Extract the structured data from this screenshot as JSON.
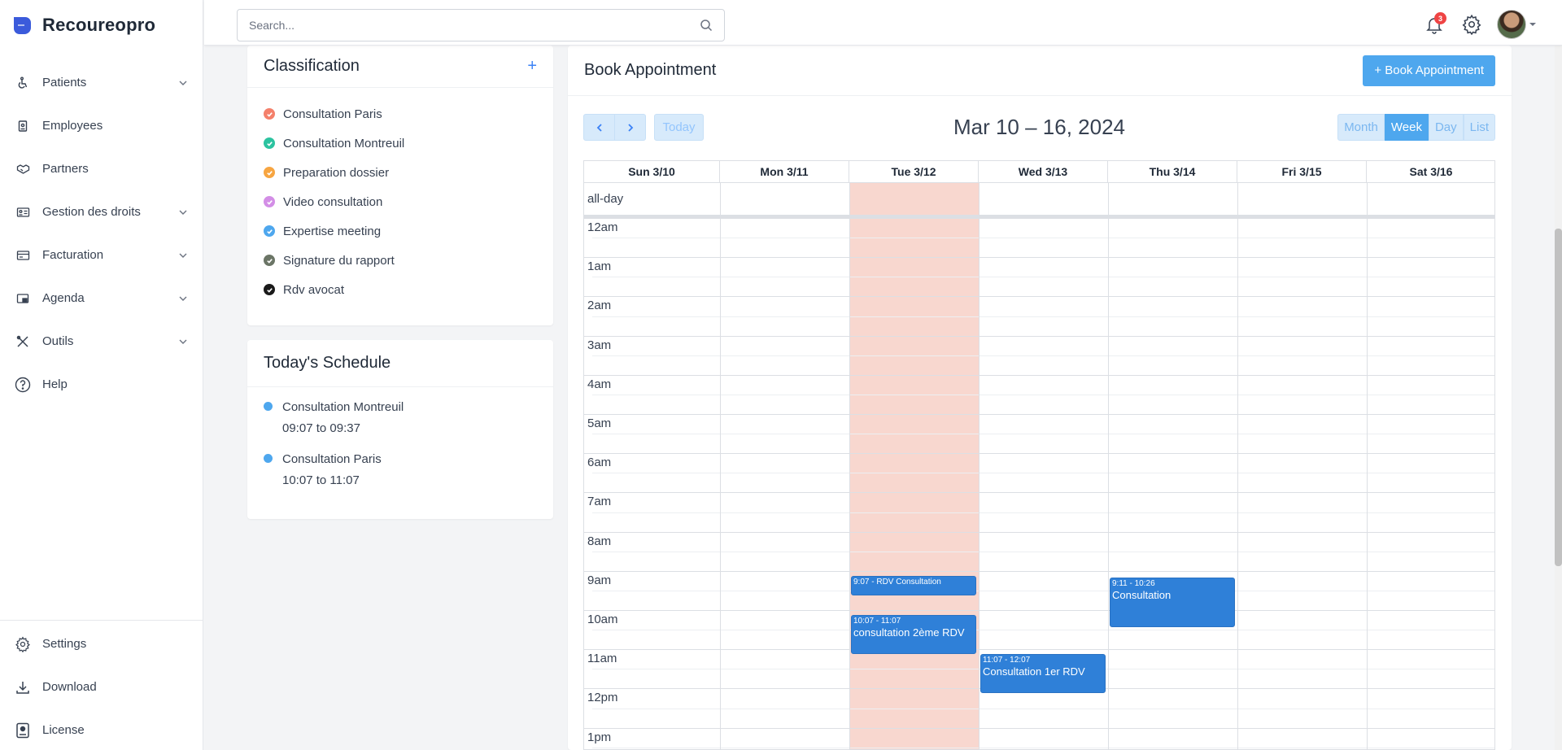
{
  "brand": {
    "name": "Recoureopro"
  },
  "sidebar": {
    "items": [
      {
        "label": "Patients",
        "icon": "wheelchair-icon",
        "has_submenu": true
      },
      {
        "label": "Employees",
        "icon": "badge-icon",
        "has_submenu": false
      },
      {
        "label": "Partners",
        "icon": "handshake-icon",
        "has_submenu": false
      },
      {
        "label": "Gestion des droits",
        "icon": "id-card-icon",
        "has_submenu": true
      },
      {
        "label": "Facturation",
        "icon": "billing-icon",
        "has_submenu": true
      },
      {
        "label": "Agenda",
        "icon": "calendar-icon",
        "has_submenu": true
      },
      {
        "label": "Outils",
        "icon": "tools-icon",
        "has_submenu": true
      },
      {
        "label": "Help",
        "icon": "help-icon",
        "has_submenu": false
      }
    ],
    "bottom": [
      {
        "label": "Settings",
        "icon": "gear-icon"
      },
      {
        "label": "Download",
        "icon": "download-icon"
      },
      {
        "label": "License",
        "icon": "license-icon"
      }
    ]
  },
  "topbar": {
    "search_placeholder": "Search...",
    "notification_count": "3"
  },
  "classification": {
    "title": "Classification",
    "add_label": "+",
    "items": [
      {
        "label": "Consultation Paris",
        "color": "#f4806b"
      },
      {
        "label": "Consultation Montreuil",
        "color": "#2cc3a0"
      },
      {
        "label": "Preparation dossier",
        "color": "#f7a541"
      },
      {
        "label": "Video consultation",
        "color": "#d38ee6"
      },
      {
        "label": "Expertise meeting",
        "color": "#4ea7ee"
      },
      {
        "label": "Signature du rapport",
        "color": "#6b7566"
      },
      {
        "label": "Rdv avocat",
        "color": "#1a1a1a"
      }
    ]
  },
  "schedule": {
    "title": "Today's Schedule",
    "items": [
      {
        "title": "Consultation Montreuil",
        "time": "09:07 to 09:37"
      },
      {
        "title": "Consultation Paris",
        "time": "10:07 to 11:07"
      }
    ]
  },
  "calendar": {
    "title": "Book Appointment",
    "book_button": "+ Book Appointment",
    "range_title": "Mar 10 – 16, 2024",
    "today_label": "Today",
    "views": [
      "Month",
      "Week",
      "Day",
      "List"
    ],
    "active_view": "Week",
    "days": [
      "Sun 3/10",
      "Mon 3/11",
      "Tue 3/12",
      "Wed 3/13",
      "Thu 3/14",
      "Fri 3/15",
      "Sat 3/16"
    ],
    "today_index": 2,
    "allday_label": "all-day",
    "hours": [
      "12am",
      "1am",
      "2am",
      "3am",
      "4am",
      "5am",
      "6am",
      "7am",
      "8am",
      "9am",
      "10am",
      "11am",
      "12pm",
      "1pm"
    ],
    "events": [
      {
        "day": 2,
        "start": 9.12,
        "end": 9.62,
        "time": "9:07 - RDV Consultation",
        "title": ""
      },
      {
        "day": 2,
        "start": 10.12,
        "end": 11.12,
        "time": "10:07 - 11:07",
        "title": "consultation 2ème RDV"
      },
      {
        "day": 3,
        "start": 11.12,
        "end": 12.12,
        "time": "11:07 - 12:07",
        "title": "Consultation 1er RDV"
      },
      {
        "day": 4,
        "start": 9.18,
        "end": 10.43,
        "time": "9:11 - 10:26",
        "title": "Consultation"
      }
    ]
  },
  "colors": {
    "accent": "#4ea7ee",
    "event": "#2f80d8",
    "today_bg": "#f8d7cf"
  }
}
